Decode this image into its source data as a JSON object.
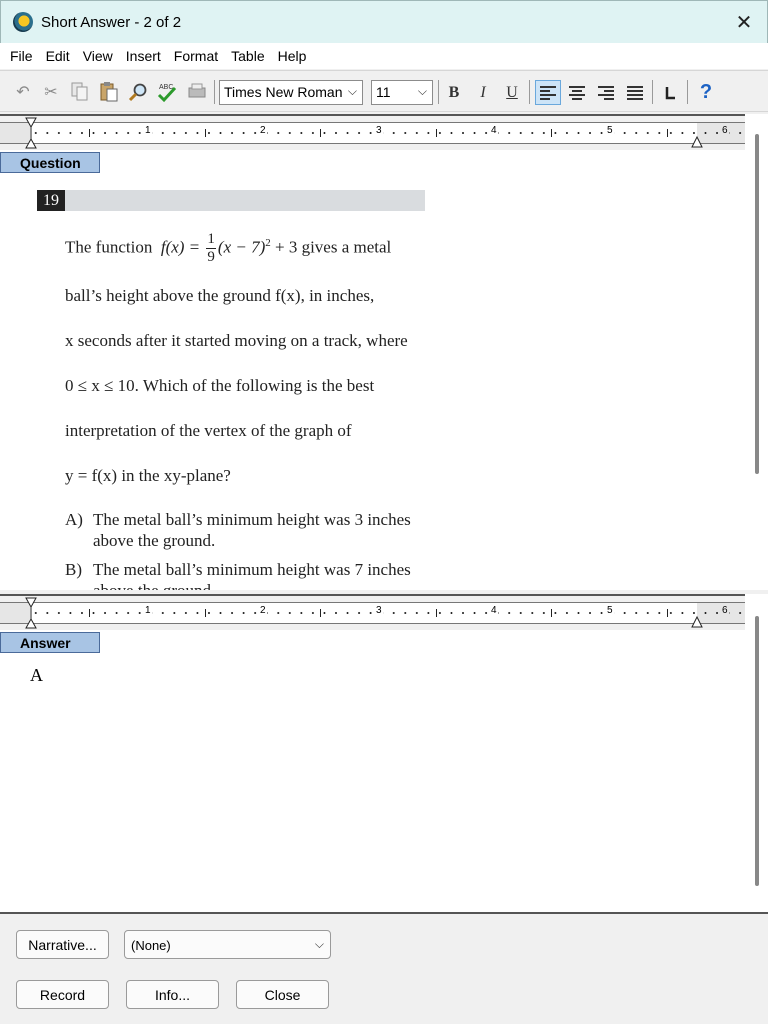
{
  "window": {
    "title": "Short Answer - 2 of 2"
  },
  "menu": [
    "File",
    "Edit",
    "View",
    "Insert",
    "Format",
    "Table",
    "Help"
  ],
  "toolbar": {
    "font_name": "Times New Roman",
    "font_size": "11",
    "bold_label": "B",
    "italic_label": "I",
    "underline_label": "U",
    "spell_label": "ABC",
    "help_label": "?"
  },
  "ruler": {
    "numbers": [
      "1",
      "2",
      "3",
      "4",
      "5",
      "6"
    ]
  },
  "question": {
    "section_label": "Question",
    "number": "19",
    "lines": {
      "l1_a": "The function",
      "l1_fx": "f(x) =",
      "l1_num": "1",
      "l1_den": "9",
      "l1_b": "(x − 7)",
      "l1_exp": "2",
      "l1_c": " + 3 gives a metal",
      "l2": "ball’s height above the ground  f(x), in inches,",
      "l3": "x seconds after it started moving on a track, where",
      "l4": "0 ≤ x ≤ 10. Which of the following is the best",
      "l5": "interpretation of the vertex of the graph of",
      "l6": "y = f(x)  in the xy-plane?"
    },
    "choices": [
      {
        "letter": "A)",
        "text1": "The metal ball’s minimum height was 3 inches",
        "text2": "above the ground."
      },
      {
        "letter": "B)",
        "text1": "The metal ball’s minimum height was 7 inches",
        "text2": "above the ground."
      }
    ]
  },
  "answer": {
    "section_label": "Answer",
    "text": "A"
  },
  "bottom": {
    "narrative_button": "Narrative...",
    "narrative_select": "(None)",
    "record_button": "Record",
    "info_button": "Info...",
    "close_button": "Close"
  }
}
